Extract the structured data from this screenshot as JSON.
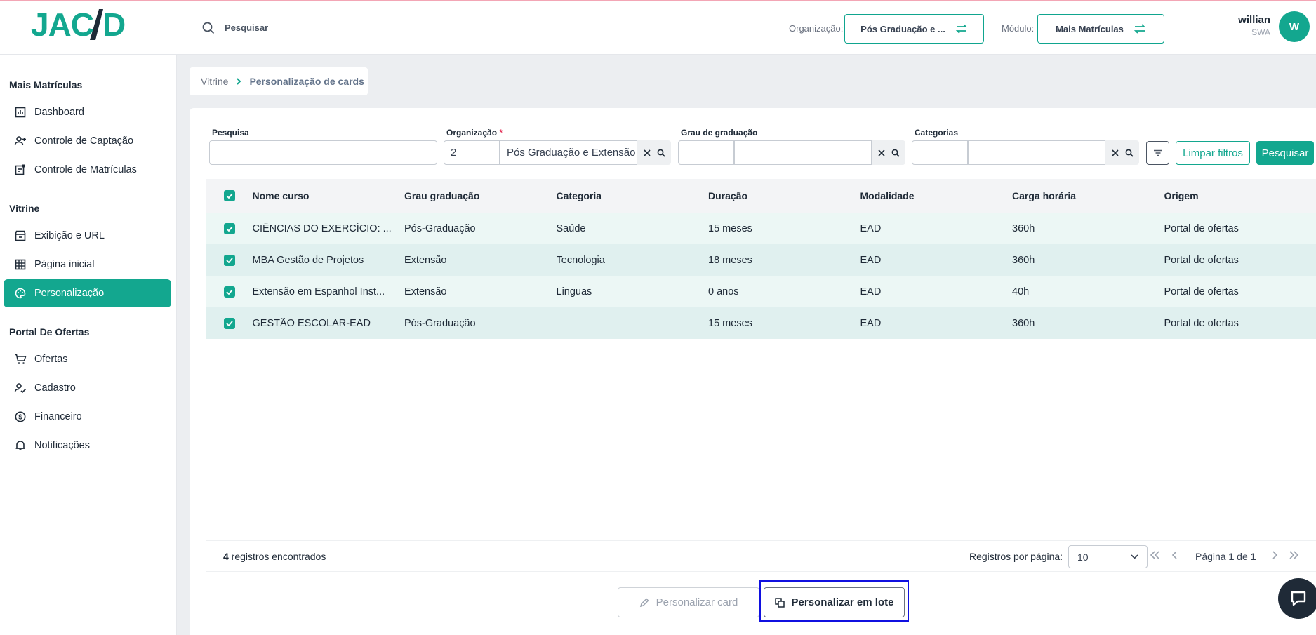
{
  "app": {
    "logo_text": "JACAD"
  },
  "header": {
    "search_placeholder": "Pesquisar",
    "org_label": "Organização:",
    "org_value": "Pós Graduação e ...",
    "module_label": "Módulo:",
    "module_value": "Mais Matrículas",
    "user_name": "willian",
    "user_role": "SWA",
    "avatar_initial": "W"
  },
  "sidebar": {
    "sections": [
      {
        "title": "Mais Matrículas",
        "items": [
          {
            "label": "Dashboard",
            "icon": "chart-icon"
          },
          {
            "label": "Controle de Captação",
            "icon": "user-add-icon"
          },
          {
            "label": "Controle de Matrículas",
            "icon": "doc-icon"
          }
        ]
      },
      {
        "title": "Vitrine",
        "items": [
          {
            "label": "Exibição e URL",
            "icon": "store-icon"
          },
          {
            "label": "Página inicial",
            "icon": "grid-icon"
          },
          {
            "label": "Personalização",
            "icon": "palette-icon",
            "active": true
          }
        ]
      },
      {
        "title": "Portal De Ofertas",
        "items": [
          {
            "label": "Ofertas",
            "icon": "cart-icon"
          },
          {
            "label": "Cadastro",
            "icon": "user-check-icon"
          },
          {
            "label": "Financeiro",
            "icon": "dollar-icon"
          },
          {
            "label": "Notificações",
            "icon": "bell-icon"
          }
        ]
      }
    ]
  },
  "breadcrumb": {
    "parent": "Vitrine",
    "current": "Personalização de cards"
  },
  "filters": {
    "search_label": "Pesquisa",
    "org_label": "Organização",
    "org_required": "*",
    "org_code": "2",
    "org_name": "Pós Graduação e Extensão",
    "grau_label": "Grau de graduação",
    "cat_label": "Categorias",
    "clear_label": "Limpar filtros",
    "search_btn": "Pesquisar"
  },
  "table": {
    "headers": [
      "Nome curso",
      "Grau graduação",
      "Categoria",
      "Duração",
      "Modalidade",
      "Carga horária",
      "Origem"
    ],
    "rows": [
      [
        "CIÊNCIAS DO EXERCÍCIO: ...",
        "Pós-Graduação",
        "Saúde",
        "15 meses",
        "EAD",
        "360h",
        "Portal de ofertas"
      ],
      [
        "MBA Gestão de Projetos",
        "Extensão",
        "Tecnologia",
        "18 meses",
        "EAD",
        "360h",
        "Portal de ofertas"
      ],
      [
        "Extensão em Espanhol Inst...",
        "Extensão",
        "Linguas",
        "0 anos",
        "EAD",
        "40h",
        "Portal de ofertas"
      ],
      [
        "GESTÃO ESCOLAR-EAD",
        "Pós-Graduação",
        "",
        "15 meses",
        "EAD",
        "360h",
        "Portal de ofertas"
      ]
    ]
  },
  "footer": {
    "count": "4",
    "count_suffix": " registros encontrados",
    "per_page_label": "Registros por página:",
    "per_page_value": "10",
    "page_prefix": "Página ",
    "page_current": "1",
    "page_of": " de ",
    "page_total": "1"
  },
  "actions": {
    "customize_card": "Personalizar card",
    "customize_batch": "Personalizar em lote"
  },
  "colors": {
    "accent": "#13a78f",
    "highlight": "#1010e0"
  }
}
